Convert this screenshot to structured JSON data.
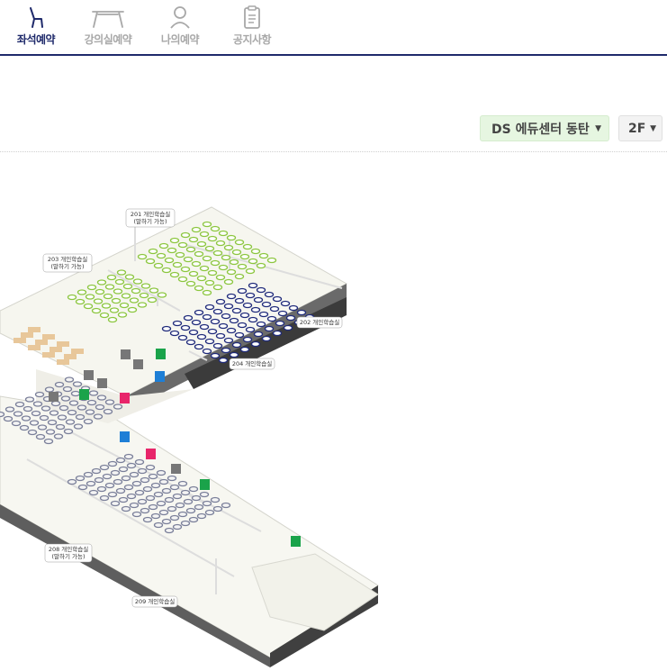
{
  "nav": {
    "items": [
      {
        "label": "좌석예약",
        "icon": "seat-icon",
        "active": true
      },
      {
        "label": "강의실예약",
        "icon": "desk-icon",
        "active": false
      },
      {
        "label": "나의예약",
        "icon": "person-icon",
        "active": false
      },
      {
        "label": "공지사항",
        "icon": "clipboard-icon",
        "active": false
      }
    ]
  },
  "controls": {
    "building": "DS 에듀센터 동탄",
    "floor": "2F"
  },
  "map": {
    "rooms": {
      "r201": [
        "201 개인학습실",
        "(말하기 가능)"
      ],
      "r202": [
        "202 개인학습실"
      ],
      "r203": [
        "203 개인학습실",
        "(말하기 가능)"
      ],
      "r204": [
        "204 개인학습실"
      ],
      "r208": [
        "208 개인학습실",
        "(말하기 가능)"
      ],
      "r209": [
        "209 개인학습실"
      ]
    }
  },
  "colors": {
    "nav_active": "#1f2a6b",
    "nav_inactive": "#a8a8a8",
    "seat_green": "#8cc63f",
    "seat_navy": "#1f2a7a",
    "exit_green": "#1aa34a",
    "restroom_blue": "#1e7fd6",
    "restroom_pink": "#e8256a"
  }
}
